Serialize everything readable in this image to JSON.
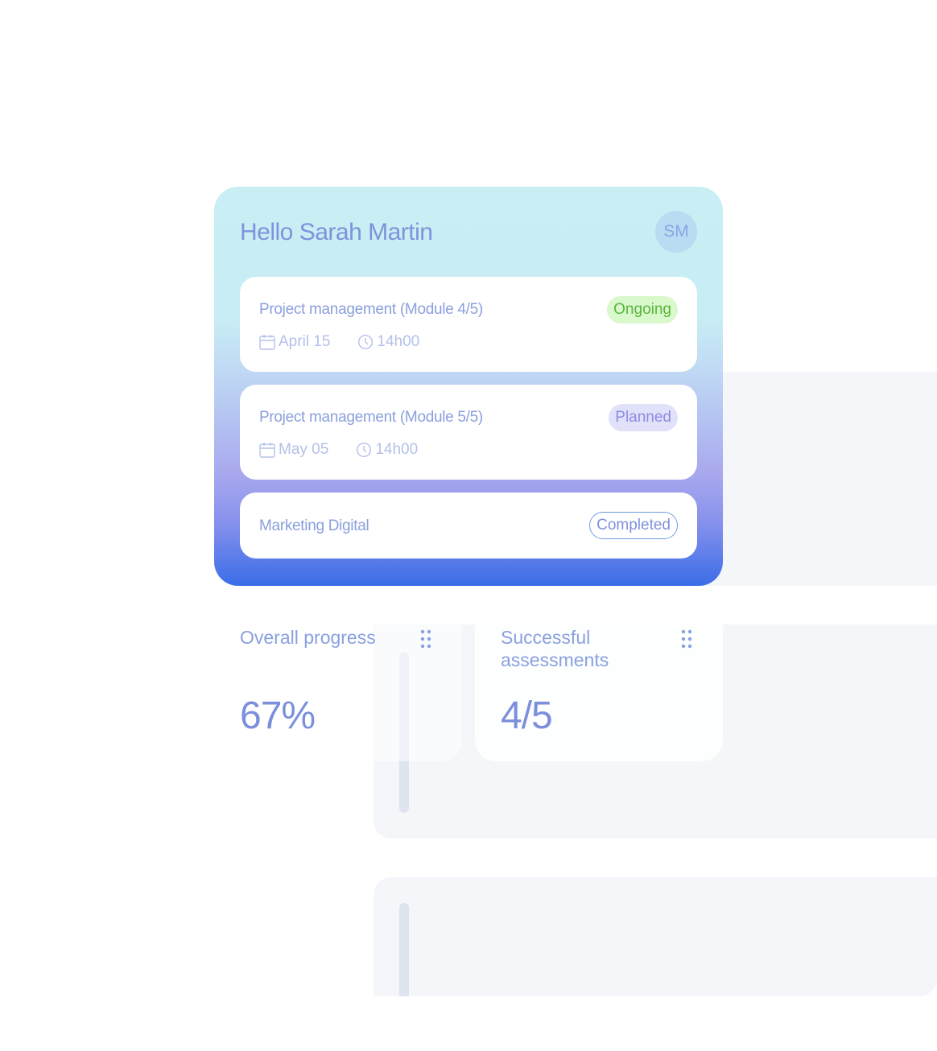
{
  "greeting": "Hello Sarah Martin",
  "avatar_initials": "SM",
  "sessions": [
    {
      "title": "Project management (Module 4/5)",
      "status": "Ongoing",
      "date": "April 15",
      "time": "14h00"
    },
    {
      "title": "Project management (Module 5/5)",
      "status": "Planned",
      "date": "May 05",
      "time": "14h00"
    },
    {
      "title": "Marketing Digital",
      "status": "Completed"
    }
  ],
  "stats": {
    "progress": {
      "label": "Overall progress",
      "value": "67%"
    },
    "assessments": {
      "label": "Successful assessments",
      "value": "4/5"
    }
  },
  "icons": {
    "date": "calendar-icon",
    "time": "clock-icon",
    "drag": "drag-handle-icon"
  },
  "colors": {
    "ongoing": "#58b53c",
    "planned": "#8d8be3",
    "completed_border": "#6f9ee3",
    "gradient_top": "#c9eef4",
    "gradient_bottom": "#3b6de8"
  }
}
